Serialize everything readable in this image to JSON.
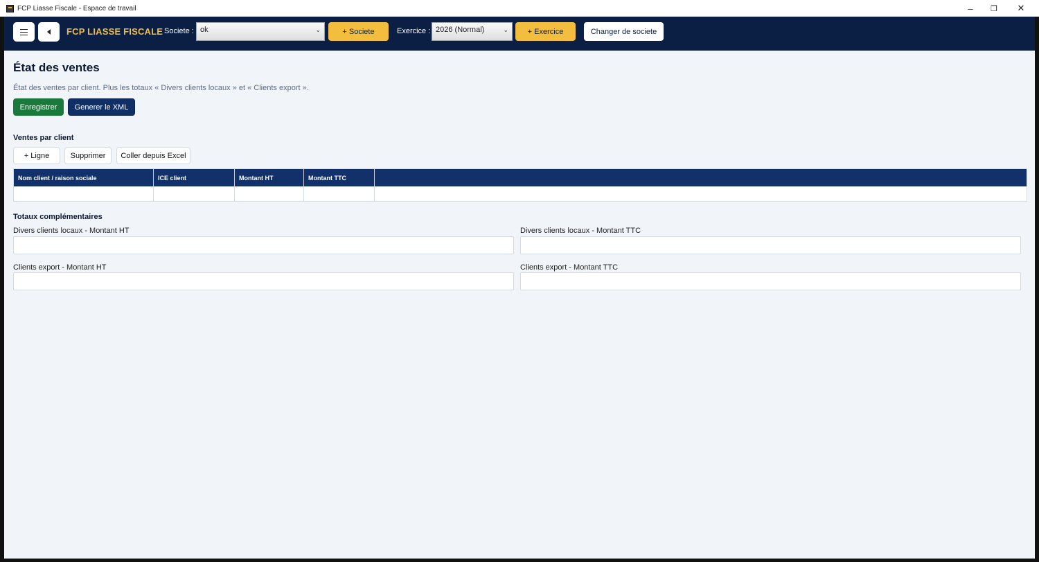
{
  "window": {
    "title": "FCP Liasse Fiscale - Espace de travail",
    "minimize": "–",
    "maximize": "❐",
    "close": "✕"
  },
  "header": {
    "brand": "FCP LIASSE FISCALE",
    "societe_label": "Societe :",
    "societe_value": "ok",
    "add_societe": "+ Societe",
    "exercice_label": "Exercice :",
    "exercice_value": "2026 (Normal)",
    "add_exercice": "+ Exercice",
    "change_societe": "Changer de societe"
  },
  "page": {
    "title": "État des ventes",
    "description": "État des ventes par client. Plus les totaux « Divers clients locaux » et « Clients export ».",
    "save_button": "Enregistrer",
    "xml_button": "Generer le XML"
  },
  "ventes": {
    "section_title": "Ventes par client",
    "add_row": "+ Ligne",
    "delete": "Supprimer",
    "paste_excel": "Coller depuis Excel",
    "columns": [
      "Nom client / raison sociale",
      "ICE client",
      "Montant HT",
      "Montant TTC",
      ""
    ],
    "rows": [
      [
        "",
        "",
        "",
        "",
        ""
      ]
    ]
  },
  "totaux": {
    "section_title": "Totaux complémentaires",
    "fields": {
      "locaux_ht": {
        "label": "Divers clients locaux - Montant HT",
        "value": ""
      },
      "locaux_ttc": {
        "label": "Divers clients locaux - Montant TTC",
        "value": ""
      },
      "export_ht": {
        "label": "Clients export - Montant HT",
        "value": ""
      },
      "export_ttc": {
        "label": "Clients export - Montant TTC",
        "value": ""
      }
    }
  }
}
